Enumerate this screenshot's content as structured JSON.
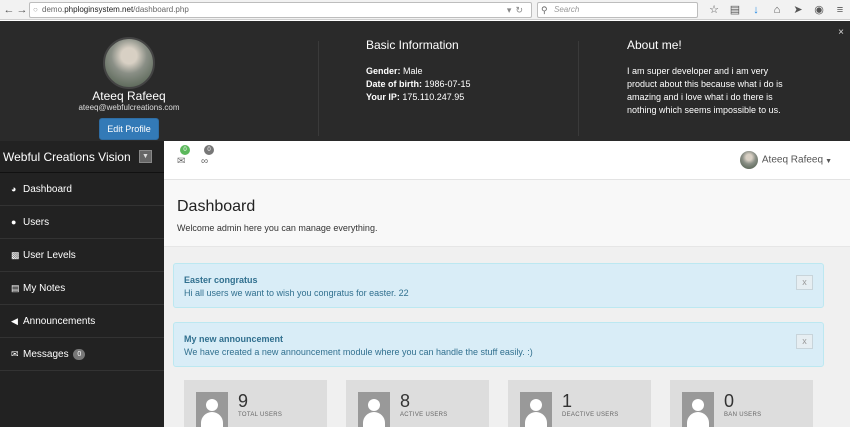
{
  "browser": {
    "url_prefix": "demo.",
    "url_domain": "phploginsystem.net",
    "url_path": "/dashboard.php",
    "search_placeholder": "Search"
  },
  "profile": {
    "name": "Ateeq Rafeeq",
    "email": "ateeq@webfulcreations.com",
    "edit_button": "Edit Profile",
    "basic_title": "Basic Information",
    "gender_label": "Gender:",
    "gender_value": "Male",
    "dob_label": "Date of birth:",
    "dob_value": "1986-07-15",
    "ip_label": "Your IP:",
    "ip_value": "175.110.247.95",
    "about_title": "About me!",
    "about_text": "I am super developer and i am very product about this because what i do is amazing and i love what i do there is nothing which seems impossible to us."
  },
  "sidebar": {
    "brand": "Webful Creations Vision",
    "items": [
      {
        "label": "Dashboard",
        "icon": "dashboard-icon"
      },
      {
        "label": "Users",
        "icon": "user-icon"
      },
      {
        "label": "User Levels",
        "icon": "folder-open-icon"
      },
      {
        "label": "My Notes",
        "icon": "list-icon"
      },
      {
        "label": "Announcements",
        "icon": "bullhorn-icon"
      },
      {
        "label": "Messages",
        "icon": "envelope-icon",
        "badge": "0"
      }
    ]
  },
  "topnav": {
    "messages_count": "0",
    "attachments_count": "0",
    "user_name": "Ateeq Rafeeq"
  },
  "main": {
    "title": "Dashboard",
    "subtitle": "Welcome admin here you can manage everything.",
    "announcements": [
      {
        "title": "Easter congratus",
        "message": "Hi all users we want to wish you congratus for easter. 22",
        "close": "x"
      },
      {
        "title": "My new announcement",
        "message": "We have created a new announcement module where you can handle the stuff easily. :)",
        "close": "x"
      }
    ],
    "stats": [
      {
        "value": "9",
        "label": "TOTAL USERS"
      },
      {
        "value": "8",
        "label": "ACTIVE USERS"
      },
      {
        "value": "1",
        "label": "DEACTIVE USERS"
      },
      {
        "value": "0",
        "label": "BAN USERS"
      }
    ]
  },
  "colors": {
    "header_bg": "#2a2a2a",
    "sidebar_bg": "#222222",
    "primary_button": "#337ab7",
    "alert_bg": "#d9edf7",
    "alert_text": "#31708f",
    "messages_badge": "#5cb85c",
    "attachments_badge": "#777777"
  }
}
